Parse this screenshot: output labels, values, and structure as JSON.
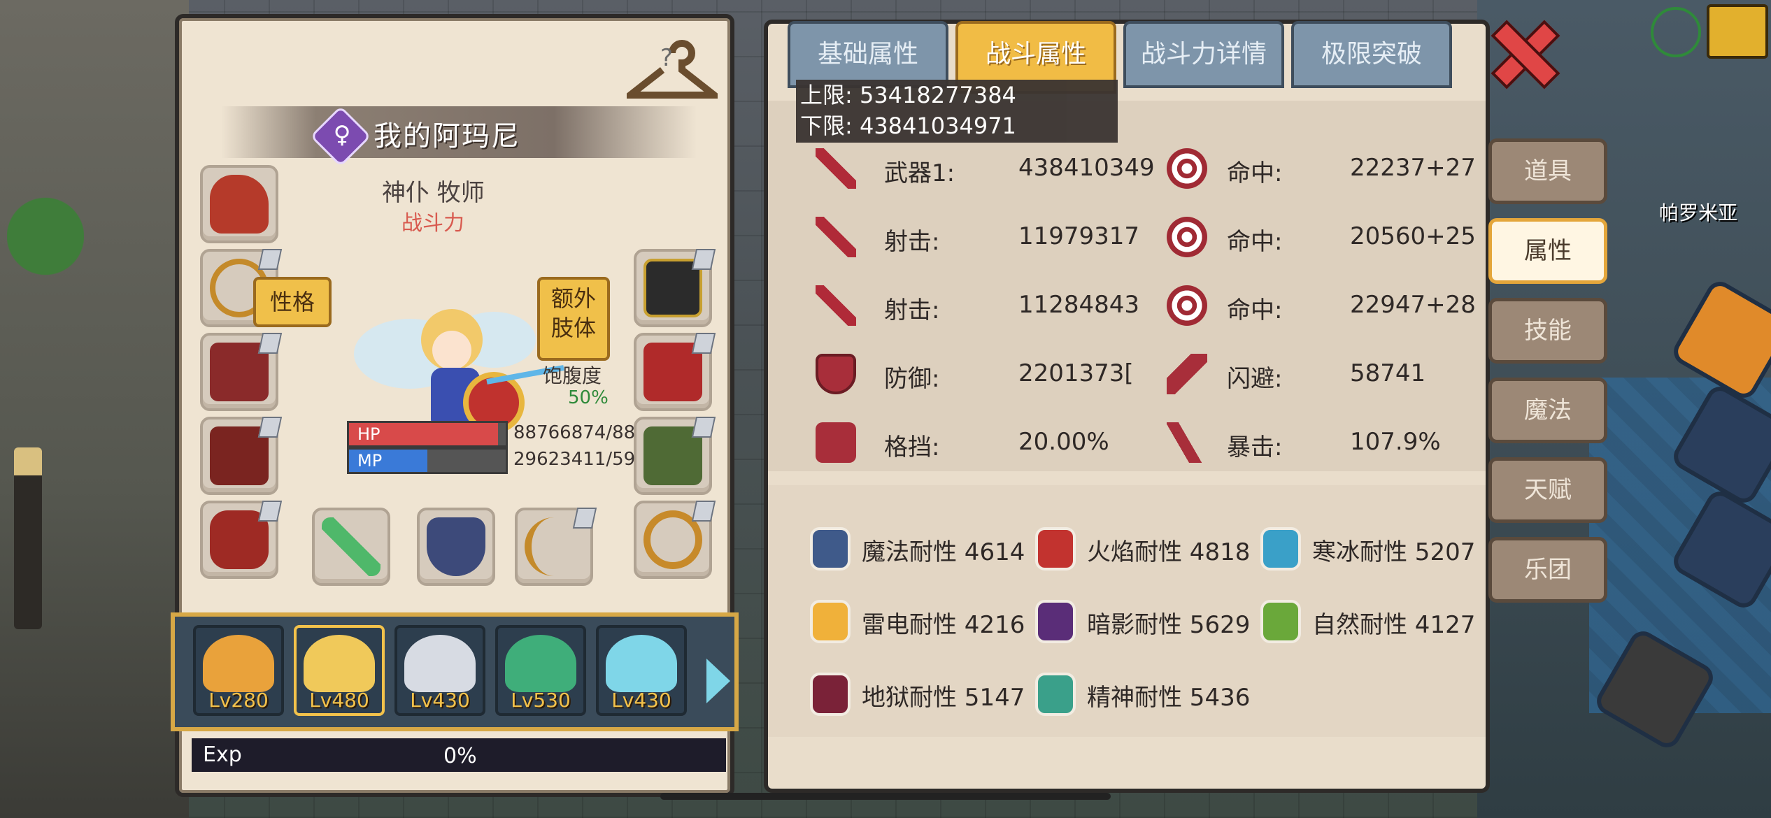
{
  "character": {
    "name": "我的阿玛尼",
    "gender_symbol": "♀",
    "job": "神仆 牧师",
    "power_label": "战斗力",
    "personality_button": "性格",
    "extra_limb_button": "额外\n肢体",
    "hunger_label": "饱腹度",
    "hunger_value": "50%",
    "hp_label": "HP",
    "hp_value": "88766874/88",
    "hp_fraction": 0.95,
    "mp_label": "MP",
    "mp_value": "29623411/59",
    "mp_fraction": 0.5,
    "exp_label": "Exp",
    "exp_value": "0%"
  },
  "party": [
    {
      "level": "Lv280",
      "active": false,
      "color": "#e9a23b"
    },
    {
      "level": "Lv480",
      "active": true,
      "color": "#f0c95a"
    },
    {
      "level": "Lv430",
      "active": false,
      "color": "#d7dbe3"
    },
    {
      "level": "Lv530",
      "active": false,
      "color": "#3fae7a"
    },
    {
      "level": "Lv430",
      "active": false,
      "color": "#7fd6e8"
    }
  ],
  "tabs": [
    "基础属性",
    "战斗属性",
    "战斗力详情",
    "极限突破"
  ],
  "active_tab": 1,
  "limits": {
    "upper": "上限: 53418277384",
    "lower": "下限: 43841034971"
  },
  "stats": [
    {
      "left_icon": "sword-icon",
      "left_label": "武器1:",
      "left_value": "438410349",
      "right_icon": "target-icon",
      "right_label": "命中:",
      "right_value": "22237+27"
    },
    {
      "left_icon": "sword-icon",
      "left_label": "射击:",
      "left_value": "11979317",
      "right_icon": "target-icon",
      "right_label": "命中:",
      "right_value": "20560+25"
    },
    {
      "left_icon": "sword-icon",
      "left_label": "射击:",
      "left_value": "11284843",
      "right_icon": "target-icon",
      "right_label": "命中:",
      "right_value": "22947+28"
    },
    {
      "left_icon": "shield-icon",
      "left_label": "防御:",
      "left_value": "2201373[",
      "right_icon": "dodge-icon",
      "right_label": "闪避:",
      "right_value": "58741"
    },
    {
      "left_icon": "block-icon",
      "left_label": "格挡:",
      "left_value": "20.00%",
      "right_icon": "crit-icon",
      "right_label": "暴击:",
      "right_value": "107.9%"
    }
  ],
  "resistances": [
    {
      "text": "魔法耐性 4614",
      "icon": "magic-resist-icon",
      "color": "#3f5a8a"
    },
    {
      "text": "火焰耐性 4818",
      "icon": "fire-resist-icon",
      "color": "#c2332f"
    },
    {
      "text": "寒冰耐性 5207",
      "icon": "ice-resist-icon",
      "color": "#3aa0c8"
    },
    {
      "text": "雷电耐性 4216",
      "icon": "thunder-resist-icon",
      "color": "#f0b13a"
    },
    {
      "text": "暗影耐性 5629",
      "icon": "shadow-resist-icon",
      "color": "#5a2d78"
    },
    {
      "text": "自然耐性 4127",
      "icon": "nature-resist-icon",
      "color": "#6aa83a"
    },
    {
      "text": "地狱耐性 5147",
      "icon": "hell-resist-icon",
      "color": "#7a2238"
    },
    {
      "text": "精神耐性 5436",
      "icon": "spirit-resist-icon",
      "color": "#3aa08a"
    }
  ],
  "side_menu": [
    "道具",
    "属性",
    "技能",
    "魔法",
    "天赋",
    "乐团"
  ],
  "active_side": 1,
  "map_label": "帕罗米亚"
}
